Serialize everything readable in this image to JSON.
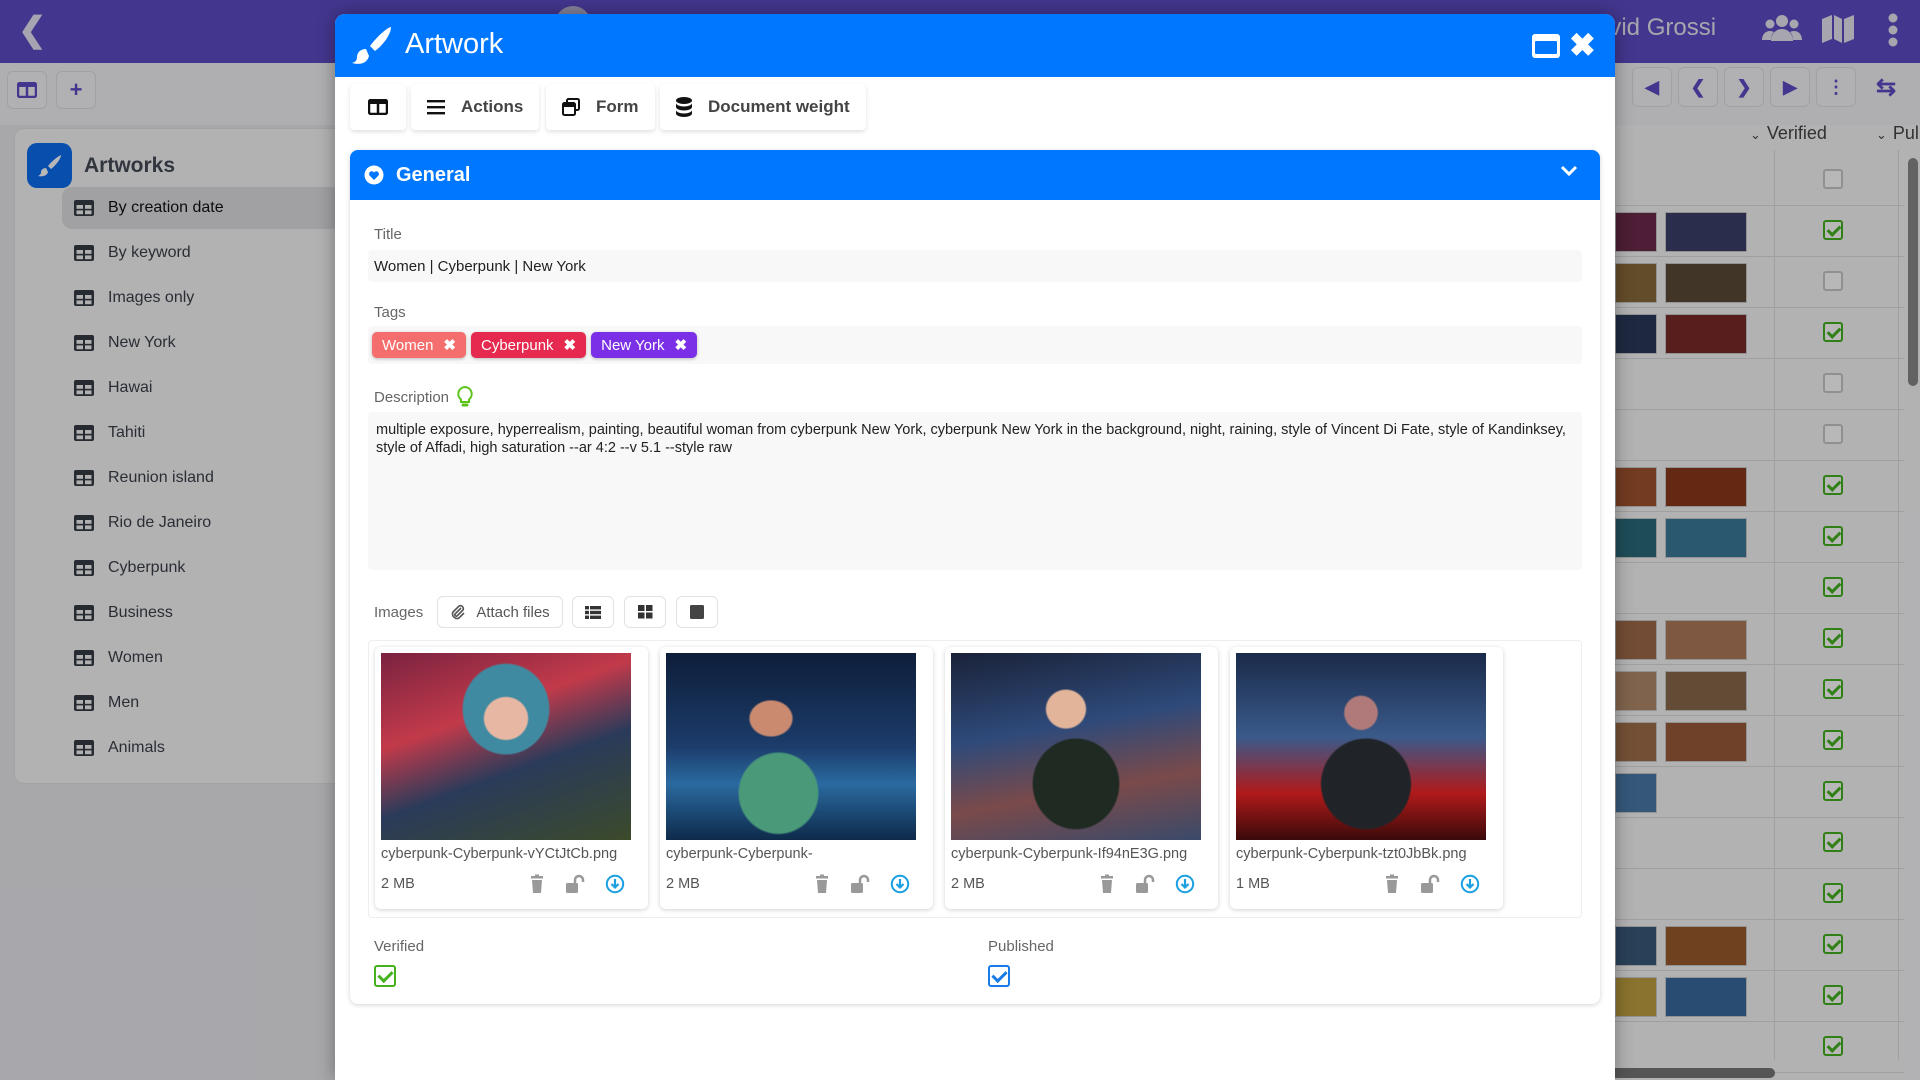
{
  "app": {
    "user_name": "avid Grossi",
    "sidebar": {
      "title": "Artworks",
      "items": [
        {
          "label": "By creation date",
          "active": true
        },
        {
          "label": "By keyword"
        },
        {
          "label": "Images only"
        },
        {
          "label": "New York"
        },
        {
          "label": "Hawai"
        },
        {
          "label": "Tahiti"
        },
        {
          "label": "Reunion island"
        },
        {
          "label": "Rio de Janeiro"
        },
        {
          "label": "Cyberpunk"
        },
        {
          "label": "Business"
        },
        {
          "label": "Women"
        },
        {
          "label": "Men"
        },
        {
          "label": "Animals"
        }
      ]
    },
    "columns": {
      "verified": "Verified",
      "published": "Pul"
    },
    "verified_rows": [
      false,
      true,
      false,
      true,
      false,
      false,
      true,
      true,
      true,
      true,
      true,
      true,
      true,
      true,
      true,
      true,
      true,
      true
    ]
  },
  "modal": {
    "title": "Artwork",
    "toolbar": {
      "actions": "Actions",
      "form": "Form",
      "document_weight": "Document weight"
    },
    "section": {
      "title": "General",
      "title_label": "Title",
      "title_value": "Women | Cyberpunk | New York",
      "tags_label": "Tags",
      "tags": [
        {
          "label": "Women",
          "color": "#f46e6e"
        },
        {
          "label": "Cyberpunk",
          "color": "#e6294e"
        },
        {
          "label": "New York",
          "color": "#7b2fe6"
        }
      ],
      "description_label": "Description",
      "description_value": "multiple exposure, hyperrealism, painting, beautiful woman from cyberpunk New York, cyberpunk New York in the background, night, raining, style of Vincent Di Fate, style of Kandinksey, style of Affadi, high saturation --ar 4:2 --v 5.1 --style raw",
      "images_label": "Images",
      "attach_label": "Attach files",
      "images": [
        {
          "file_name": "cyberpunk-Cyberpunk-vYCtJtCb.png",
          "size": "2 MB"
        },
        {
          "file_name": "cyberpunk-Cyberpunk-",
          "size": "2 MB"
        },
        {
          "file_name": "cyberpunk-Cyberpunk-If94nE3G.png",
          "size": "2 MB"
        },
        {
          "file_name": "cyberpunk-Cyberpunk-tzt0JbBk.png",
          "size": "1 MB"
        }
      ],
      "verified_label": "Verified",
      "verified": true,
      "published_label": "Published",
      "published": true
    }
  },
  "colors": {
    "primary": "#0077ff",
    "app_bar": "#5e4cc5",
    "verified_green": "#45b121",
    "published_blue": "#1b7be6",
    "download_blue": "#1a9fe0"
  }
}
